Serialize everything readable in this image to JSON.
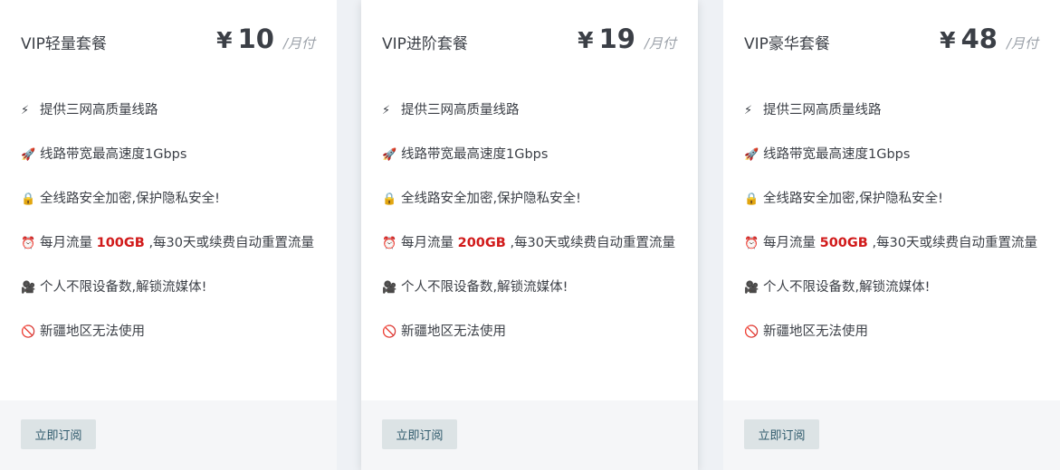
{
  "plans": [
    {
      "name": "VIP轻量套餐",
      "currency": "¥",
      "price": "10",
      "period": "/月付",
      "features": [
        {
          "icon": "lightning-icon",
          "glyph": "⚡",
          "text": "提供三网高质量线路"
        },
        {
          "icon": "rocket-icon",
          "glyph": "🚀",
          "text": "线路带宽最高速度1Gbps"
        },
        {
          "icon": "lock-icon",
          "glyph": "🔒",
          "text": "全线路安全加密,保护隐私安全!"
        },
        {
          "icon": "alarm-clock-icon",
          "glyph": "⏰",
          "pre": "每月流量 ",
          "highlight": "100GB",
          "post": " ,每30天或续费自动重置流量"
        },
        {
          "icon": "camera-icon",
          "glyph": "🎥",
          "text": "个人不限设备数,解锁流媒体!"
        },
        {
          "icon": "prohibited-icon",
          "glyph": "🚫",
          "text": "新疆地区无法使用"
        }
      ],
      "button": "立即订阅"
    },
    {
      "name": "VIP进阶套餐",
      "currency": "¥",
      "price": "19",
      "period": "/月付",
      "features": [
        {
          "icon": "lightning-icon",
          "glyph": "⚡",
          "text": "提供三网高质量线路"
        },
        {
          "icon": "rocket-icon",
          "glyph": "🚀",
          "text": "线路带宽最高速度1Gbps"
        },
        {
          "icon": "lock-icon",
          "glyph": "🔒",
          "text": "全线路安全加密,保护隐私安全!"
        },
        {
          "icon": "alarm-clock-icon",
          "glyph": "⏰",
          "pre": "每月流量 ",
          "highlight": "200GB",
          "post": " ,每30天或续费自动重置流量"
        },
        {
          "icon": "camera-icon",
          "glyph": "🎥",
          "text": "个人不限设备数,解锁流媒体!"
        },
        {
          "icon": "prohibited-icon",
          "glyph": "🚫",
          "text": "新疆地区无法使用"
        }
      ],
      "button": "立即订阅"
    },
    {
      "name": "VIP豪华套餐",
      "currency": "¥",
      "price": "48",
      "period": "/月付",
      "features": [
        {
          "icon": "lightning-icon",
          "glyph": "⚡",
          "text": "提供三网高质量线路"
        },
        {
          "icon": "rocket-icon",
          "glyph": "🚀",
          "text": "线路带宽最高速度1Gbps"
        },
        {
          "icon": "lock-icon",
          "glyph": "🔒",
          "text": "全线路安全加密,保护隐私安全!"
        },
        {
          "icon": "alarm-clock-icon",
          "glyph": "⏰",
          "pre": "每月流量 ",
          "highlight": "500GB",
          "post": " ,每30天或续费自动重置流量"
        },
        {
          "icon": "camera-icon",
          "glyph": "🎥",
          "text": "个人不限设备数,解锁流媒体!"
        },
        {
          "icon": "prohibited-icon",
          "glyph": "🚫",
          "text": "新疆地区无法使用"
        }
      ],
      "button": "立即订阅"
    }
  ],
  "colors": {
    "highlight": "#d11a1a",
    "button_bg": "#dce3e5",
    "button_text": "#2f5a6c"
  }
}
